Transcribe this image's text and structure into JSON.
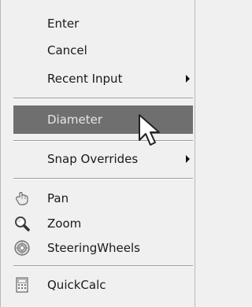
{
  "menu": {
    "enter": "Enter",
    "cancel": "Cancel",
    "recent_input": "Recent Input",
    "diameter": "Diameter",
    "snap_overrides": "Snap Overrides",
    "pan": "Pan",
    "zoom": "Zoom",
    "steering_wheels": "SteeringWheels",
    "quickcalc": "QuickCalc"
  },
  "icons": {
    "pan": "hand-icon",
    "zoom": "magnifier-icon",
    "steering_wheels": "steering-wheel-icon",
    "quickcalc": "calculator-icon",
    "submenu": "chevron-right-icon",
    "cursor": "mouse-pointer-icon"
  },
  "colors": {
    "menu_bg": "#f0f0f0",
    "highlight_bg": "#6f6f6f",
    "highlight_text": "#e6e6e6"
  }
}
